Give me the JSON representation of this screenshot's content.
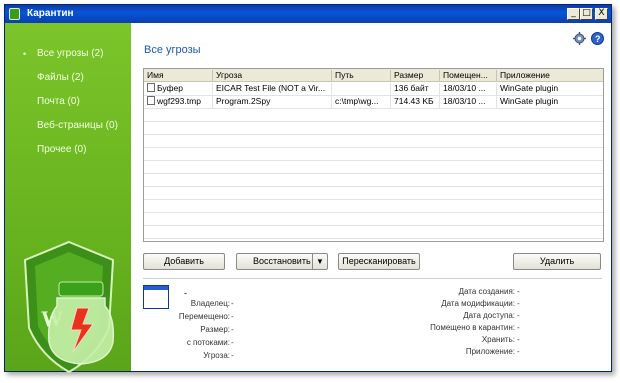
{
  "window": {
    "title": "Карантин",
    "controls": {
      "minimize": "_",
      "maximize": "□",
      "close": "X"
    }
  },
  "sidebar": {
    "items": [
      {
        "label": "Все угрозы (2)"
      },
      {
        "label": "Файлы (2)"
      },
      {
        "label": "Почта (0)"
      },
      {
        "label": "Веб-страницы (0)"
      },
      {
        "label": "Прочее (0)"
      }
    ]
  },
  "content": {
    "title": "Все угрозы"
  },
  "table": {
    "columns": [
      "Имя",
      "Угроза",
      "Путь",
      "Размер",
      "Помещен...",
      "Приложение"
    ],
    "rows": [
      [
        "Буфер",
        "EICAR Test File (NOT a Vir...",
        "",
        "136 байт",
        "18/03/10 ...",
        "WinGate plugin"
      ],
      [
        "wgf293.tmp",
        "Program.2Spy",
        "c:\\tmp\\wg...",
        "714.43 KБ",
        "18/03/10 ...",
        "WinGate plugin"
      ]
    ]
  },
  "buttons": {
    "add": "Добавить",
    "restore": "Восстановить",
    "rescan": "Пересканировать",
    "delete": "Удалить"
  },
  "details": {
    "name": "-",
    "left": [
      {
        "label": "Владелец:",
        "value": "-"
      },
      {
        "label": "Перемещено:",
        "value": "-"
      },
      {
        "label": "Размер:",
        "value": "-"
      },
      {
        "label": "с потоками:",
        "value": "-"
      },
      {
        "label": "Угроза:",
        "value": "-"
      }
    ],
    "right": [
      {
        "label": "Дата создания:",
        "value": "-"
      },
      {
        "label": "Дата модификации:",
        "value": "-"
      },
      {
        "label": "Дата доступа:",
        "value": "-"
      },
      {
        "label": "Помещено в карантин:",
        "value": "-"
      },
      {
        "label": "Хранить:",
        "value": "-"
      },
      {
        "label": "Приложение:",
        "value": "-"
      }
    ]
  },
  "colors": {
    "sidebar": "#6bb521",
    "title_blue": "#1f56b8",
    "titlebar": "#0854d8"
  },
  "icons": {
    "settings": "gear-icon",
    "help": "help-icon",
    "logo": "drweb-shield-logo"
  }
}
